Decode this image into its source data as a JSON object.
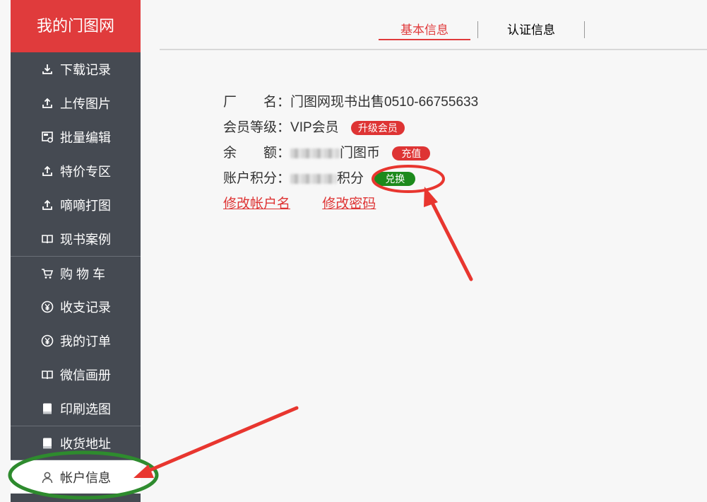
{
  "sidebar": {
    "brand": "我的门图网",
    "items": [
      {
        "label": "下载记录",
        "icon": "download-icon"
      },
      {
        "label": "上传图片",
        "icon": "upload-icon"
      },
      {
        "label": "批量编辑",
        "icon": "batch-edit-icon"
      },
      {
        "label": "特价专区",
        "icon": "upload-icon"
      },
      {
        "label": "嘀嘀打图",
        "icon": "upload-icon"
      },
      {
        "label": "现书案例",
        "icon": "book-icon"
      },
      {
        "label": "购 物 车",
        "icon": "cart-icon"
      },
      {
        "label": "收支记录",
        "icon": "yen-icon"
      },
      {
        "label": "我的订单",
        "icon": "yen-icon"
      },
      {
        "label": "微信画册",
        "icon": "book-icon"
      },
      {
        "label": "印刷选图",
        "icon": "notebook-icon"
      },
      {
        "label": "收货地址",
        "icon": "notebook-icon"
      },
      {
        "label": "帐户信息",
        "icon": "user-icon"
      }
    ]
  },
  "tabs": {
    "basic": "基本信息",
    "auth": "认证信息"
  },
  "account": {
    "factory_label": "厂　　名：",
    "factory_value": "门图网现书出售0510-66755633",
    "level_label": "会员等级：",
    "level_value": "VIP会员",
    "upgrade_button": "升级会员",
    "balance_label": "余　　额：",
    "balance_unit": "门图币",
    "recharge_button": "充值",
    "points_label": "账户积分：",
    "points_unit": "积分",
    "exchange_button": "兑换",
    "edit_name_link": "修改帐户名",
    "edit_password_link": "修改密码"
  },
  "colors": {
    "brand_red": "#e03b3c",
    "sidebar_bg": "#454a52",
    "annotation_red": "#e8362f",
    "annotation_green": "#2e8b2e",
    "exchange_green": "#1c8a1c"
  }
}
